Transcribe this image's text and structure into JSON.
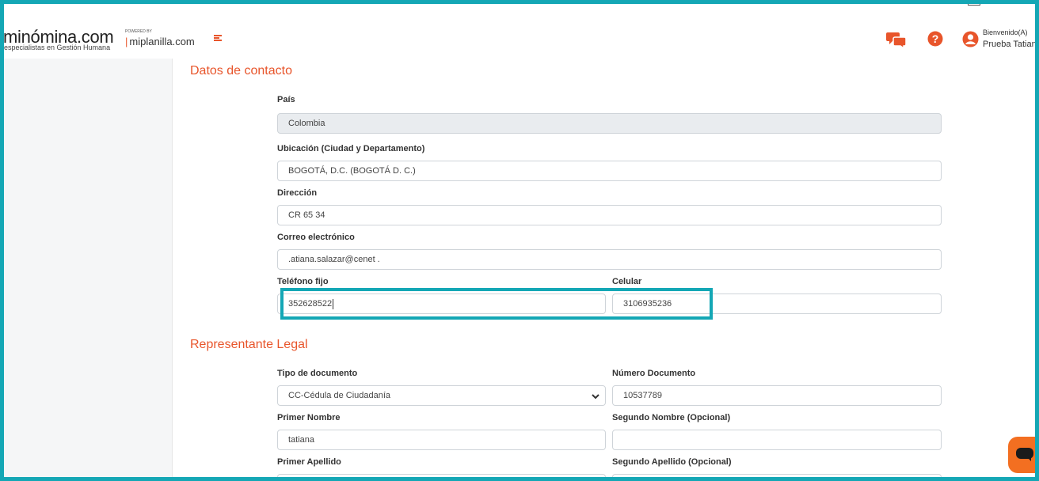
{
  "header": {
    "logo_text": "minómina.com",
    "logo_tagline": "especialistas en Gestión Humana",
    "powered_by": "POWERED BY",
    "powered_brand": "miplanilla.com",
    "welcome_label": "Bienvenido(A)",
    "user_name": "Prueba Tatiana",
    "icons": [
      "menu-icon",
      "chat-icon",
      "help-icon",
      "user-icon"
    ],
    "accent_color": "#e8552b"
  },
  "contact": {
    "title": "Datos de contacto",
    "country_label": "País",
    "country_value": "Colombia",
    "location_label": "Ubicación (Ciudad y Departamento)",
    "location_value": "BOGOTÁ, D.C. (BOGOTÁ D. C.)",
    "address_label": "Dirección",
    "address_value": "CR 65 34",
    "email_label": "Correo electrónico",
    "email_value": ".atiana.salazar@cenet  .",
    "phone_label": "Teléfono fijo",
    "phone_value": "352628522",
    "mobile_label": "Celular",
    "mobile_value": "3106935236"
  },
  "legal": {
    "title": "Representante Legal",
    "doc_type_label": "Tipo de documento",
    "doc_type_value": "CC-Cédula de Ciudadanía",
    "doc_number_label": "Número Documento",
    "doc_number_value": "10537789",
    "first_name_label": "Primer Nombre",
    "first_name_value": "tatiana",
    "second_name_label": "Segundo Nombre (Opcional)",
    "second_name_value": "",
    "first_lastname_label": "Primer Apellido",
    "second_lastname_label": "Segundo Apellido (Opcional)"
  },
  "highlight_color": "#14a7b5"
}
